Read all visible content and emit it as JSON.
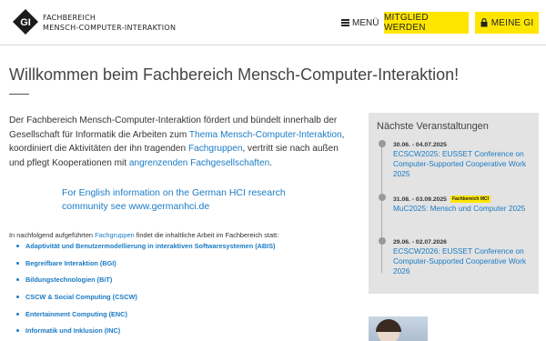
{
  "header": {
    "brand_line1": "FACHBEREICH",
    "brand_line2": "MENSCH-COMPUTER-INTERAKTION",
    "logo_text": "GI",
    "menu_label": "MENÜ",
    "member_button": "MITGLIED WERDEN",
    "meine_button": "MEINE GI"
  },
  "main": {
    "title": "Willkommen beim Fachbereich Mensch-Computer-Interaktion!",
    "intro_part1": "Der Fachbereich Mensch-Computer-Interaktion fördert und bündelt innerhalb der Gesellschaft für Informatik die Arbeiten zum ",
    "intro_link1": "Thema Mensch-Computer-Interaktion",
    "intro_part2": ", koordiniert die Aktivitäten der ihn tragenden ",
    "intro_link2": "Fachgruppen",
    "intro_part3": ", vertritt sie nach außen und pflegt Kooperationen mit ",
    "intro_link3": "angrenzenden Fachgesellschaften",
    "intro_part4": ".",
    "english_info": "For English information on the German HCI research community see www.germanhci.de",
    "list_intro_part1": "In nachfolgend aufgeführten ",
    "list_intro_link": "Fachgruppen",
    "list_intro_part2": " findet die inhaltliche Arbeit im Fachbereich statt:",
    "groups": [
      "Adaptivität und Benutzermodellierung in interaktiven Softwaresystemen (ABIS)",
      "Begreifbare Interaktion (BGI)",
      "Bildungstechnologien (BiT)",
      "CSCW & Social Computing (CSCW)",
      "Entertainment Computing (ENC)",
      "Informatik und Inklusion (INC)"
    ]
  },
  "sidebar": {
    "title": "Nächste Veranstaltungen",
    "events": [
      {
        "date": "30.06. - 04.07.2025",
        "badge": "",
        "title": "ECSCW2025: EUSSET Conference on Computer-Supported Cooperative Work 2025"
      },
      {
        "date": "31.08. - 03.09.2025",
        "badge": "Fachbereich MCI",
        "title": "MuC2025: Mensch und Computer 2025"
      },
      {
        "date": "29.06. - 02.07.2026",
        "badge": "",
        "title": "ECSCW2026: EUSSET Conference on Computer-Supported Cooperative Work 2026"
      }
    ]
  },
  "colors": {
    "accent_yellow": "#ffe600",
    "link_blue": "#1a7bc4",
    "sidebar_bg": "#e3e3e3"
  }
}
